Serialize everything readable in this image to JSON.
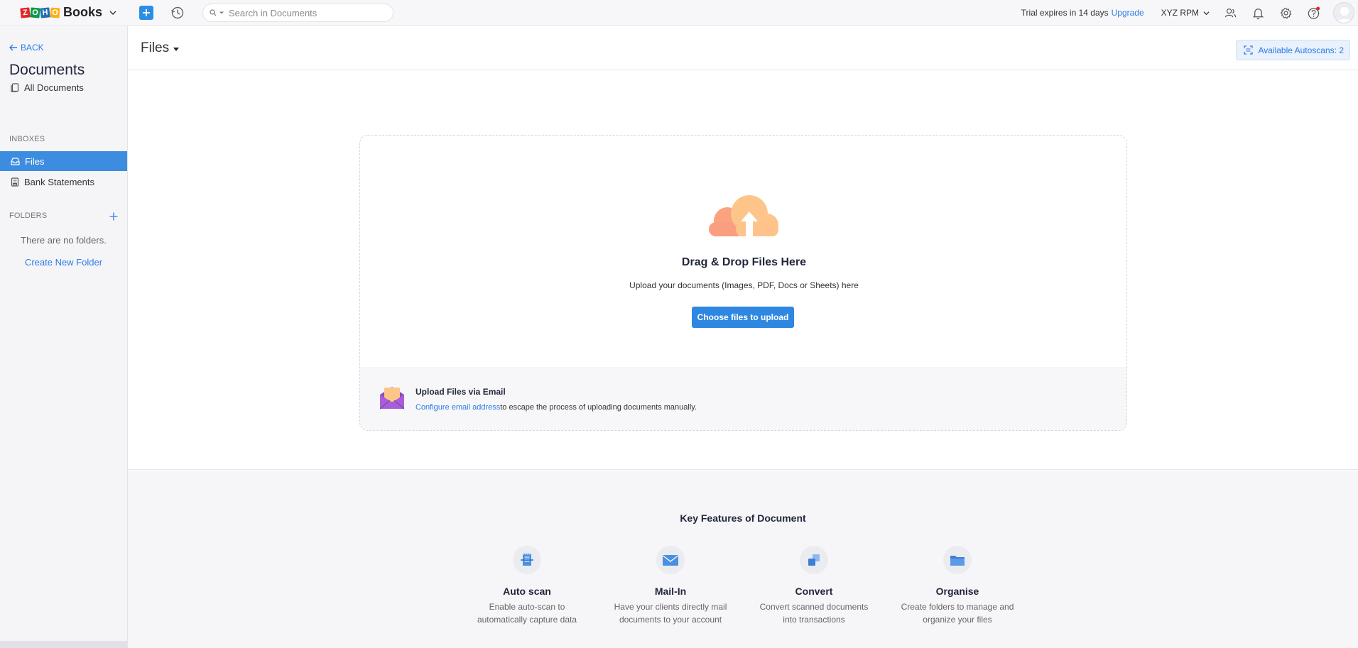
{
  "header": {
    "logo_letters": [
      "Z",
      "O",
      "H",
      "O"
    ],
    "logo_product": "Books",
    "search_placeholder": "Search in Documents",
    "trial_text": "Trial expires in 14 days",
    "upgrade_label": "Upgrade",
    "org_name": "XYZ RPM"
  },
  "sidebar": {
    "back_label": "BACK",
    "title": "Documents",
    "all_documents_label": "All Documents",
    "inboxes_heading": "INBOXES",
    "inbox_items": [
      {
        "label": "Files",
        "active": true
      },
      {
        "label": "Bank Statements",
        "active": false
      }
    ],
    "folders_heading": "FOLDERS",
    "no_folders_text": "There are no folders.",
    "create_folder_label": "Create New Folder"
  },
  "main": {
    "title": "Files",
    "autoscans_label": "Available Autoscans: 2",
    "dropzone": {
      "title": "Drag & Drop Files Here",
      "subtitle": "Upload your documents (Images, PDF, Docs or Sheets) here",
      "button_label": "Choose files to upload"
    },
    "email": {
      "title": "Upload Files via Email",
      "link_label": "Configure email address",
      "description": "to escape the process of uploading documents manually."
    },
    "features": {
      "title": "Key Features of Document",
      "items": [
        {
          "name": "Auto scan",
          "description": "Enable auto-scan to automatically capture data",
          "icon": "scan-icon"
        },
        {
          "name": "Mail-In",
          "description": "Have your clients directly mail documents to your account",
          "icon": "mail-icon"
        },
        {
          "name": "Convert",
          "description": "Convert scanned documents into transactions",
          "icon": "convert-icon"
        },
        {
          "name": "Organise",
          "description": "Create folders to manage and organize your files",
          "icon": "folder-icon"
        }
      ]
    }
  },
  "colors": {
    "accent": "#2c7be5",
    "active_sidebar": "#3c8de0",
    "primary_button": "#2e88e1"
  }
}
